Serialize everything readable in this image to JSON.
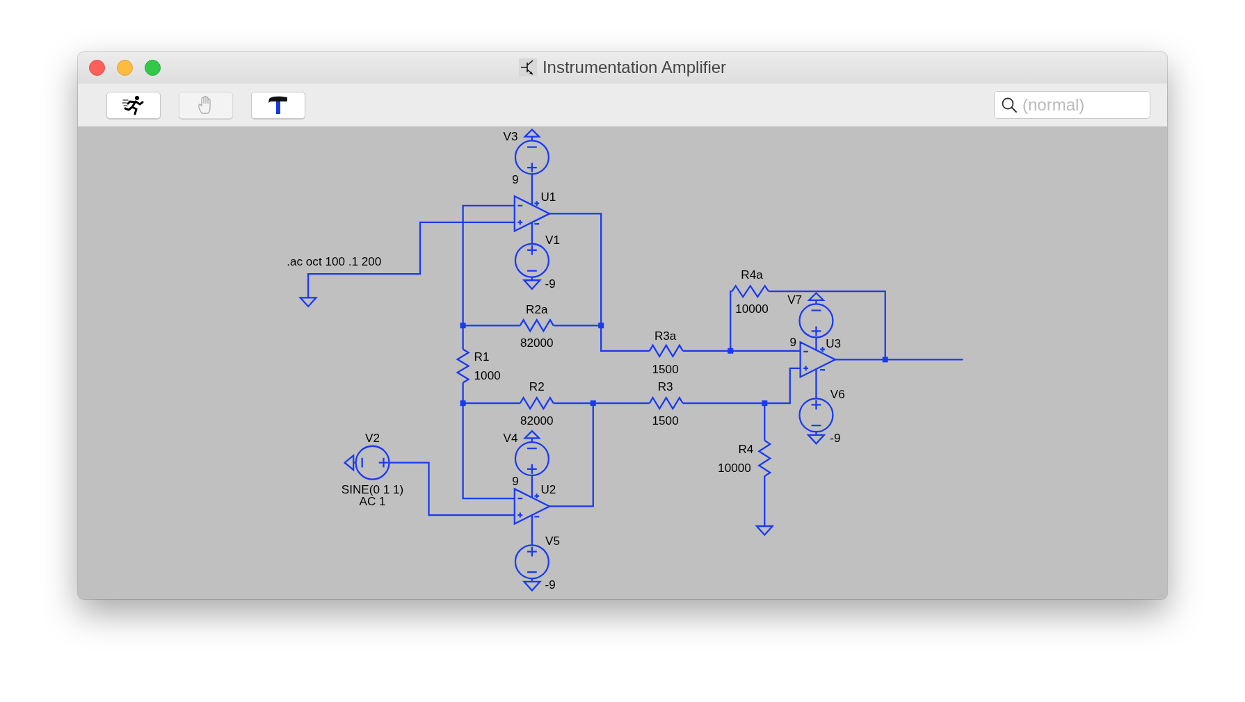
{
  "window": {
    "title": "Instrumentation Amplifier"
  },
  "toolbar": [
    {
      "kind": "run",
      "disabled": false
    },
    {
      "kind": "halt",
      "disabled": true
    },
    {
      "kind": "hammer",
      "disabled": false
    }
  ],
  "search": {
    "placeholder": "(normal)"
  },
  "schematic": {
    "directive": ".ac oct 100 .1 200",
    "components": [
      {
        "kind": "voltage_source",
        "name": "V3",
        "value": "9"
      },
      {
        "kind": "opamp",
        "name": "U1"
      },
      {
        "kind": "voltage_source",
        "name": "V1",
        "value": "-9"
      },
      {
        "kind": "resistor",
        "name": "R2a",
        "value": "82000"
      },
      {
        "kind": "resistor",
        "name": "R4a",
        "value": "10000"
      },
      {
        "kind": "voltage_source",
        "name": "V7",
        "value": "9"
      },
      {
        "kind": "resistor",
        "name": "R3a",
        "value": "1500"
      },
      {
        "kind": "opamp",
        "name": "U3"
      },
      {
        "kind": "resistor",
        "name": "R1",
        "value": "1000"
      },
      {
        "kind": "resistor",
        "name": "R2",
        "value": "82000"
      },
      {
        "kind": "resistor",
        "name": "R3",
        "value": "1500"
      },
      {
        "kind": "voltage_source",
        "name": "V6",
        "value": "-9"
      },
      {
        "kind": "sine_source",
        "name": "V2",
        "lines": [
          "SINE(0 1 1)",
          "AC 1"
        ]
      },
      {
        "kind": "voltage_source",
        "name": "V4",
        "value": "9"
      },
      {
        "kind": "opamp",
        "name": "U2"
      },
      {
        "kind": "resistor",
        "name": "R4",
        "value": "10000"
      },
      {
        "kind": "voltage_source",
        "name": "V5",
        "value": "-9"
      }
    ]
  }
}
